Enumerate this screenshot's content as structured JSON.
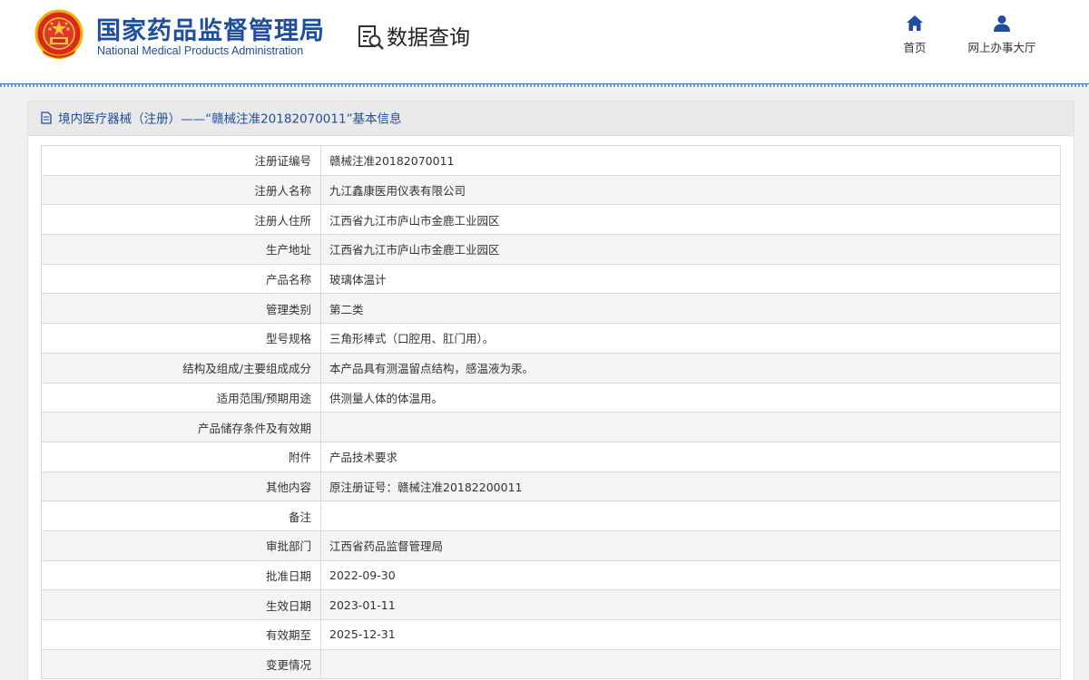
{
  "header": {
    "org_name_cn": "国家药品监督管理局",
    "org_name_en": "National Medical Products Administration",
    "page_title": "数据查询",
    "nav": [
      {
        "label": "首页",
        "icon": "home-icon"
      },
      {
        "label": "网上办事大厅",
        "icon": "user-icon"
      }
    ],
    "accent_color": "#1f4e9c"
  },
  "panel": {
    "title": "境内医疗器械（注册）——“赣械注准20182070011”基本信息"
  },
  "details": [
    {
      "label": "注册证编号",
      "value": "赣械注准20182070011"
    },
    {
      "label": "注册人名称",
      "value": "九江鑫康医用仪表有限公司"
    },
    {
      "label": "注册人住所",
      "value": "江西省九江市庐山市金鹿工业园区"
    },
    {
      "label": "生产地址",
      "value": "江西省九江市庐山市金鹿工业园区"
    },
    {
      "label": "产品名称",
      "value": "玻璃体温计"
    },
    {
      "label": "管理类别",
      "value": "第二类"
    },
    {
      "label": "型号规格",
      "value": "三角形棒式（口腔用、肛门用）。"
    },
    {
      "label": "结构及组成/主要组成成分",
      "value": "本产品具有测温留点结构，感温液为汞。"
    },
    {
      "label": "适用范围/预期用途",
      "value": "供测量人体的体温用。"
    },
    {
      "label": "产品储存条件及有效期",
      "value": ""
    },
    {
      "label": "附件",
      "value": "产品技术要求"
    },
    {
      "label": "其他内容",
      "value": "原注册证号：赣械注准20182200011"
    },
    {
      "label": "备注",
      "value": ""
    },
    {
      "label": "审批部门",
      "value": "江西省药品监督管理局"
    },
    {
      "label": "批准日期",
      "value": "2022-09-30"
    },
    {
      "label": "生效日期",
      "value": "2023-01-11"
    },
    {
      "label": "有效期至",
      "value": "2025-12-31"
    },
    {
      "label": "变更情况",
      "value": ""
    }
  ]
}
